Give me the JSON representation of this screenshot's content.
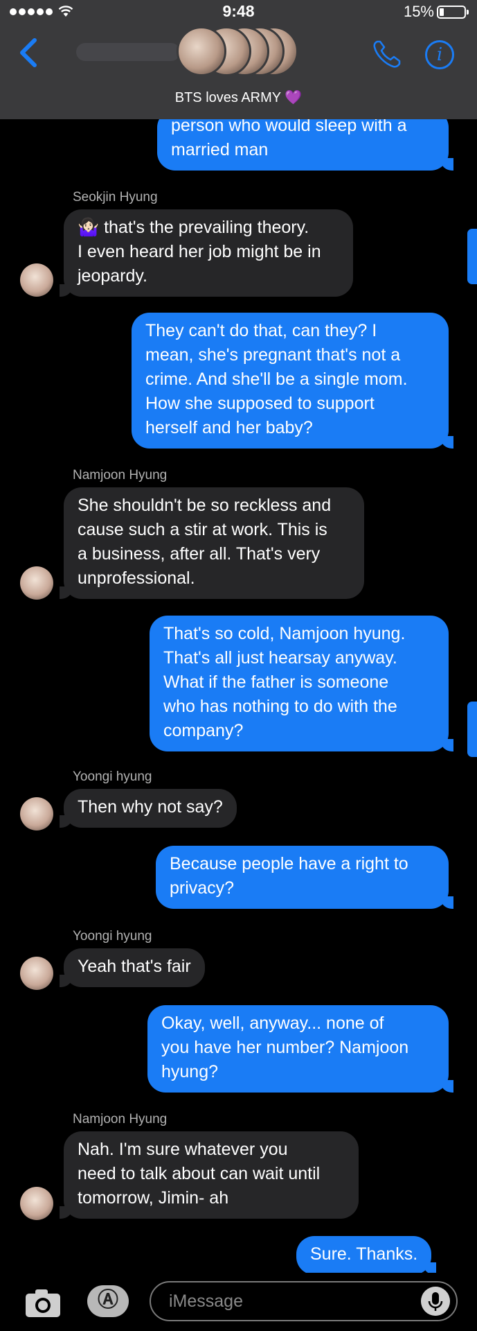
{
  "status_bar": {
    "time": "9:48",
    "battery": "15%"
  },
  "header": {
    "group_name": "BTS loves ARMY",
    "group_emoji": "💜"
  },
  "messages": [
    {
      "lines": [
        "person who would sleep with a",
        "married man"
      ]
    },
    {
      "sender": "Seokjin Hyung",
      "lines": [
        "🤷🏻‍♀️ that's the prevailing theory.",
        "I even heard her job might be in",
        "jeopardy."
      ]
    },
    {
      "lines": [
        "They can't do that, can they? I",
        "mean, she's pregnant that's not a",
        "crime. And she'll be a single mom.",
        "How she supposed to support",
        "herself and her baby?"
      ]
    },
    {
      "sender": "Namjoon Hyung",
      "lines": [
        "She shouldn't be so reckless and",
        "cause such a stir at work. This is",
        "a business, after all. That's very",
        "unprofessional."
      ]
    },
    {
      "lines": [
        "That's so cold, Namjoon hyung.",
        "That's all just hearsay anyway.",
        "What if the father is someone",
        "who has nothing to do with the",
        "company?"
      ]
    },
    {
      "sender": "Yoongi hyung",
      "lines": [
        "Then why not say?"
      ]
    },
    {
      "lines": [
        "Because people have a right to",
        "privacy?"
      ]
    },
    {
      "sender": "Yoongi hyung",
      "lines": [
        "Yeah that's fair"
      ]
    },
    {
      "lines": [
        "Okay, well, anyway... none of",
        "you have her number? Namjoon",
        "hyung?"
      ]
    },
    {
      "sender": "Namjoon Hyung",
      "lines": [
        "Nah. I'm sure whatever you",
        "need to talk about can wait until",
        "tomorrow, Jimin- ah"
      ]
    },
    {
      "lines": [
        "Sure. Thanks."
      ]
    }
  ],
  "composer": {
    "placeholder": "iMessage"
  },
  "colors": {
    "accent": "#1a7cf5",
    "incoming_bubble": "#262628",
    "header_bg": "#3a3a3c"
  }
}
